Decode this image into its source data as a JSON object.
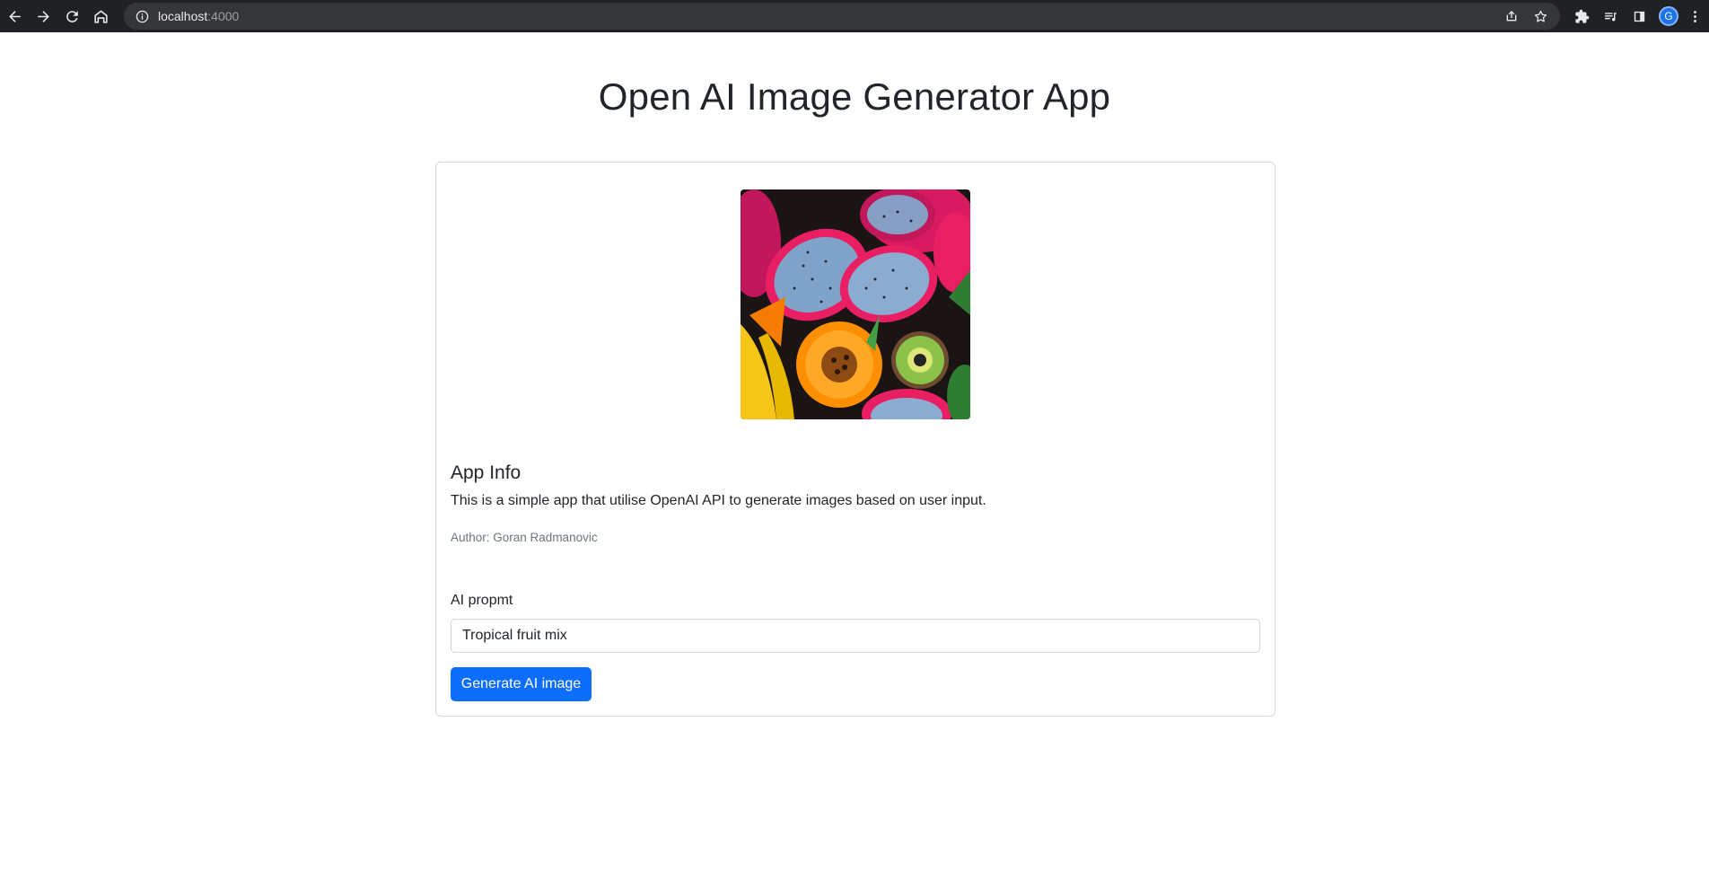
{
  "browser": {
    "url_host": "localhost",
    "url_port": ":4000",
    "profile_initial": "G",
    "icons": [
      "back-arrow-icon",
      "forward-arrow-icon",
      "reload-icon",
      "home-icon",
      "info-icon",
      "share-icon",
      "star-icon",
      "extensions-icon",
      "media-queue-icon",
      "side-panel-icon",
      "kebab-menu-icon"
    ]
  },
  "page": {
    "title": "Open AI Image Generator App"
  },
  "card": {
    "image_alt": "Tropical fruit mix",
    "section_title": "App Info",
    "description": "This is a simple app that utilise OpenAI API to generate images based on user input.",
    "author": "Author: Goran Radmanovic",
    "prompt_label": "AI propmt",
    "prompt_value": "Tropical fruit mix",
    "generate_button": "Generate AI image"
  },
  "colors": {
    "chrome_bg": "#202124",
    "primary": "#0d6efd",
    "text": "#212529",
    "muted": "#6c757d"
  }
}
